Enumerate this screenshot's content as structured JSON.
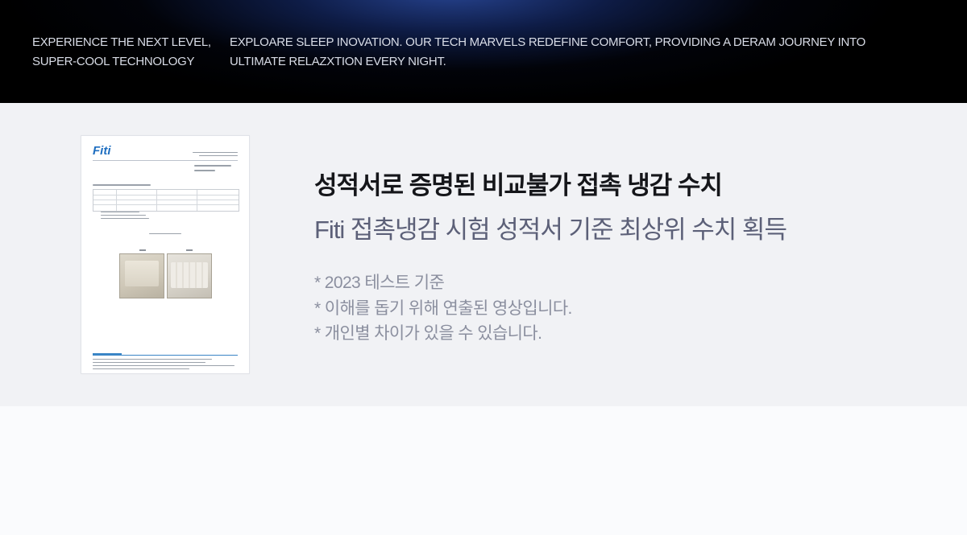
{
  "hero": {
    "tagline": "EXPERIENCE THE NEXT LEVEL, SUPER-COOL TECHNOLOGY",
    "description": "EXPLOARE SLEEP INOVATION. OUR TECH MARVELS REDEFINE COMFORT, PROVIDING A DERAM JOURNEY INTO ULTIMATE RELAZXTION EVERY NIGHT."
  },
  "certificate": {
    "logo_text": "Fiti"
  },
  "main": {
    "title": "성적서로 증명된 비교불가 접촉 냉감 수치",
    "subtitle": "Fiti 접촉냉감 시험 성적서 기준 최상위 수치 획득",
    "notes": [
      "* 2023 테스트 기준",
      "* 이해를 돕기 위해 연출된 영상입니다.",
      "* 개인별 차이가 있을 수 있습니다."
    ]
  },
  "colors": {
    "hero_background": "#000000",
    "hero_glow": "#284696",
    "section_background": "#f1f2f5",
    "title": "#15161a",
    "subtitle": "#5c6078",
    "notes": "#8b8f9f",
    "logo": "#1e6ec0"
  }
}
